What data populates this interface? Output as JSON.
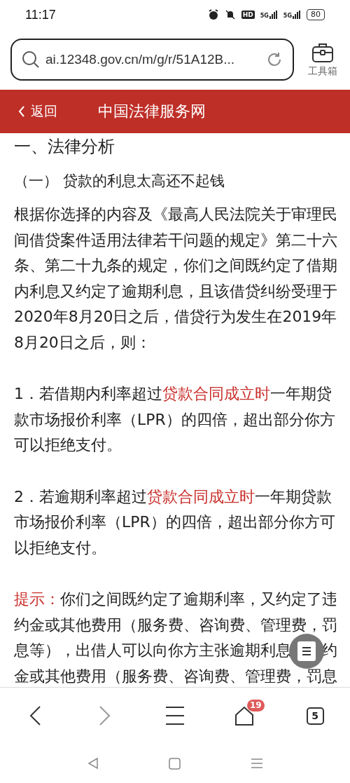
{
  "status_bar": {
    "time": "11:17",
    "battery": "80",
    "network_1": "5G",
    "network_2": "5G",
    "hd": "HD"
  },
  "browser": {
    "url": "ai.12348.gov.cn/m/g/r/51A12B...",
    "toolbox_label": "工具箱"
  },
  "header": {
    "back_label": "返回",
    "title": "中国法律服务网"
  },
  "article": {
    "heading": "一、法律分析",
    "subheading": "（一） 贷款的利息太高还不起钱",
    "paragraphs": [
      [
        {
          "text": "根据你选择的内容及《最高人民法院关于审理民间借贷案件适用法律若干问题的规定》第二十六条、第二十九条的规定，你们之间既约定了借期内利息又约定了逾期利息，且该借贷纠纷受理于2020年8月20日之后，借贷行为发生在2019年8月20日之后，则：",
          "highlight": false
        }
      ],
      [
        {
          "text": "1．若借期内利率超过",
          "highlight": false
        },
        {
          "text": "贷款合同成立时",
          "highlight": true
        },
        {
          "text": "一年期贷款市场报价利率（LPR）的四倍，超出部分你方可以拒绝支付。",
          "highlight": false
        }
      ],
      [
        {
          "text": "2．若逾期利率超过",
          "highlight": false
        },
        {
          "text": "贷款合同成立时",
          "highlight": true
        },
        {
          "text": "一年期贷款市场报价利率（LPR）的四倍，超出部分你方可以拒绝支付。",
          "highlight": false
        }
      ]
    ],
    "tip": {
      "segments": [
        {
          "text": "提示：",
          "highlight": true
        },
        {
          "text": "你们之间既约定了逾期利率，又约定了违约金或其他费用（服务费、咨询费、管理费，罚息等），出借人可以向你方主张逾期利息",
          "highlight": false
        }
      ],
      "text_after_button": "约金或其他费用（服务费、咨询费、管理费，罚息"
    }
  },
  "bottom_nav": {
    "notification_count": "19",
    "tab_count": "5"
  }
}
